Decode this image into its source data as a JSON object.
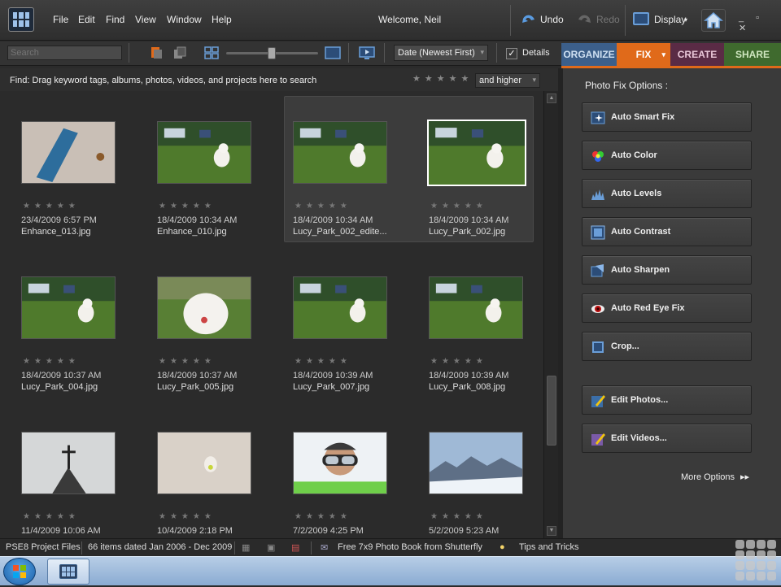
{
  "menubar": {
    "menus": [
      "File",
      "Edit",
      "Find",
      "View",
      "Window",
      "Help"
    ],
    "welcome": "Welcome, Neil",
    "undo": "Undo",
    "redo": "Redo",
    "display": "Display",
    "window_controls": "_ ▫ ✕"
  },
  "toolbar": {
    "search_placeholder": "Search",
    "zoom_level": 0.5,
    "sort": "Date (Newest First)",
    "details_label": "Details",
    "details_checked": true
  },
  "tabs": {
    "organize": "ORGANIZE",
    "fix": "FIX",
    "create": "CREATE",
    "share": "SHARE",
    "active": "FIX"
  },
  "findbar": {
    "text": "Find: Drag keyword tags, albums, photos, videos, and projects here to search",
    "rating_filter": "and higher"
  },
  "photos": [
    {
      "date": "23/4/2009 6:57 PM",
      "name": "Enhance_013.jpg",
      "subject": "skateboard"
    },
    {
      "date": "18/4/2009 10:34 AM",
      "name": "Enhance_010.jpg",
      "subject": "dog-park"
    },
    {
      "date": "18/4/2009 10:34 AM",
      "name": "Lucy_Park_002_edite...",
      "subject": "dog-park",
      "selected_group": true
    },
    {
      "date": "18/4/2009 10:34 AM",
      "name": "Lucy_Park_002.jpg",
      "subject": "dog-park",
      "selected": true
    },
    {
      "date": "18/4/2009 10:37 AM",
      "name": "Lucy_Park_004.jpg",
      "subject": "dog-park"
    },
    {
      "date": "18/4/2009 10:37 AM",
      "name": "Lucy_Park_005.jpg",
      "subject": "dog-close"
    },
    {
      "date": "18/4/2009 10:39 AM",
      "name": "Lucy_Park_007.jpg",
      "subject": "dog-park"
    },
    {
      "date": "18/4/2009 10:39 AM",
      "name": "Lucy_Park_008.jpg",
      "subject": "dog-park"
    },
    {
      "date": "11/4/2009 10:06 AM",
      "name": "",
      "subject": "steeple"
    },
    {
      "date": "10/4/2009 2:18 PM",
      "name": "",
      "subject": "dog-snow"
    },
    {
      "date": "7/2/2009 4:25 PM",
      "name": "",
      "subject": "skier"
    },
    {
      "date": "5/2/2009 5:23 AM",
      "name": "",
      "subject": "mountains"
    }
  ],
  "fix_panel": {
    "title": "Photo Fix Options :",
    "buttons": [
      {
        "label": "Auto Smart Fix",
        "icon": "smart-fix-icon"
      },
      {
        "label": "Auto Color",
        "icon": "color-wheel-icon"
      },
      {
        "label": "Auto Levels",
        "icon": "levels-icon"
      },
      {
        "label": "Auto Contrast",
        "icon": "contrast-icon"
      },
      {
        "label": "Auto Sharpen",
        "icon": "sharpen-icon"
      },
      {
        "label": "Auto Red Eye Fix",
        "icon": "red-eye-icon"
      },
      {
        "label": "Crop...",
        "icon": "crop-icon"
      },
      {
        "label": "Edit Photos...",
        "icon": "edit-photos-icon"
      },
      {
        "label": "Edit Videos...",
        "icon": "edit-videos-icon"
      }
    ],
    "more": "More Options",
    "more_arrow": "▸▸"
  },
  "statusbar": {
    "project": "PSE8 Project Files",
    "count": "66 items dated Jan 2006 - Dec 2009",
    "promo": "Free 7x9 Photo Book from Shutterfly",
    "tips": "Tips and Tricks"
  },
  "colors": {
    "accent_fix": "#e06a1a",
    "organize": "#3c5f8a",
    "create": "#5a2b45",
    "share": "#3f6a2e"
  }
}
